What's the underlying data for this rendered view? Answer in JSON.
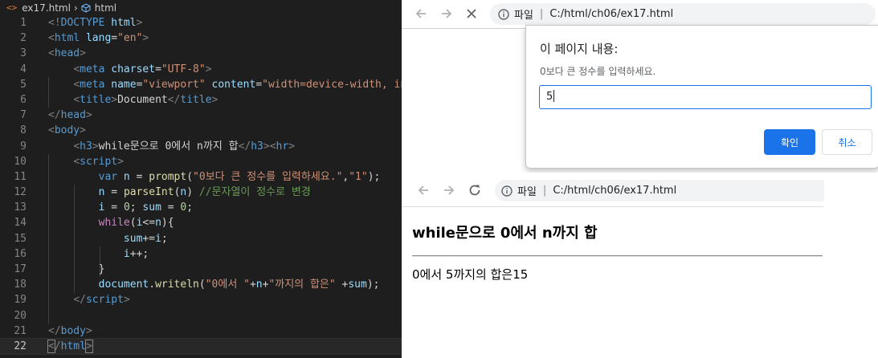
{
  "editor": {
    "breadcrumb": {
      "file": "ex17.html",
      "element": "html",
      "file_icon": "html-file-icon",
      "element_icon": "cube-icon"
    },
    "colors": {
      "background": "#1e1e1e",
      "tag": "#569cd6",
      "attribute": "#9cdcfe",
      "string": "#ce9178",
      "comment": "#6a9955",
      "function": "#dcdcaa",
      "keyword_control": "#c586c0",
      "number": "#b5cea8"
    },
    "active_line": 22,
    "lines": [
      {
        "n": "1",
        "segs": [
          [
            "t-br",
            "<!"
          ],
          [
            "t-tag",
            "DOCTYPE"
          ],
          [
            "t-at",
            " html"
          ],
          [
            "t-br",
            ">"
          ]
        ]
      },
      {
        "n": "2",
        "segs": [
          [
            "t-br",
            "<"
          ],
          [
            "t-tag",
            "html"
          ],
          [
            "t-at",
            " lang"
          ],
          [
            "t-tx",
            "="
          ],
          [
            "t-str",
            "\"en\""
          ],
          [
            "t-br",
            ">"
          ]
        ]
      },
      {
        "n": "3",
        "segs": [
          [
            "t-br",
            "<"
          ],
          [
            "t-tag",
            "head"
          ],
          [
            "t-br",
            ">"
          ]
        ]
      },
      {
        "n": "4",
        "segs": [
          [
            "t-tx",
            "    "
          ],
          [
            "t-br",
            "<"
          ],
          [
            "t-tag",
            "meta"
          ],
          [
            "t-at",
            " charset"
          ],
          [
            "t-tx",
            "="
          ],
          [
            "t-str",
            "\"UTF-8\""
          ],
          [
            "t-br",
            ">"
          ]
        ]
      },
      {
        "n": "5",
        "segs": [
          [
            "t-tx",
            "    "
          ],
          [
            "t-br",
            "<"
          ],
          [
            "t-tag",
            "meta"
          ],
          [
            "t-at",
            " name"
          ],
          [
            "t-tx",
            "="
          ],
          [
            "t-str",
            "\"viewport\""
          ],
          [
            "t-at",
            " content"
          ],
          [
            "t-tx",
            "="
          ],
          [
            "t-str",
            "\"width=device-width, ini"
          ]
        ]
      },
      {
        "n": "6",
        "segs": [
          [
            "t-tx",
            "    "
          ],
          [
            "t-br",
            "<"
          ],
          [
            "t-tag",
            "title"
          ],
          [
            "t-br",
            ">"
          ],
          [
            "t-tx",
            "Document"
          ],
          [
            "t-br",
            "</"
          ],
          [
            "t-tag",
            "title"
          ],
          [
            "t-br",
            ">"
          ]
        ]
      },
      {
        "n": "7",
        "segs": [
          [
            "t-br",
            "</"
          ],
          [
            "t-tag",
            "head"
          ],
          [
            "t-br",
            ">"
          ]
        ]
      },
      {
        "n": "8",
        "segs": [
          [
            "t-br",
            "<"
          ],
          [
            "t-tag",
            "body"
          ],
          [
            "t-br",
            ">"
          ]
        ]
      },
      {
        "n": "9",
        "segs": [
          [
            "t-tx",
            "    "
          ],
          [
            "t-br",
            "<"
          ],
          [
            "t-tag",
            "h3"
          ],
          [
            "t-br",
            ">"
          ],
          [
            "t-tx",
            "while문으로 0에서 n까지 합"
          ],
          [
            "t-br",
            "</"
          ],
          [
            "t-tag",
            "h3"
          ],
          [
            "t-br",
            "><"
          ],
          [
            "t-tag",
            "hr"
          ],
          [
            "t-br",
            ">"
          ]
        ]
      },
      {
        "n": "10",
        "segs": [
          [
            "t-tx",
            "    "
          ],
          [
            "t-br",
            "<"
          ],
          [
            "t-tag",
            "script"
          ],
          [
            "t-br",
            ">"
          ]
        ]
      },
      {
        "n": "11",
        "segs": [
          [
            "t-tx",
            "        "
          ],
          [
            "t-kw",
            "var"
          ],
          [
            "t-var",
            " n"
          ],
          [
            "t-op",
            " = "
          ],
          [
            "t-fn",
            "prompt"
          ],
          [
            "t-op",
            "("
          ],
          [
            "t-str",
            "\"0보다 큰 정수를 입력하세요.\""
          ],
          [
            "t-op",
            ","
          ],
          [
            "t-str",
            "\"1\""
          ],
          [
            "t-op",
            ");"
          ]
        ]
      },
      {
        "n": "12",
        "segs": [
          [
            "t-tx",
            "        "
          ],
          [
            "t-var",
            "n"
          ],
          [
            "t-op",
            " = "
          ],
          [
            "t-fn",
            "parseInt"
          ],
          [
            "t-op",
            "("
          ],
          [
            "t-var",
            "n"
          ],
          [
            "t-op",
            ") "
          ],
          [
            "t-cm",
            "//문자열이 정수로 변경"
          ]
        ]
      },
      {
        "n": "13",
        "segs": [
          [
            "t-tx",
            "        "
          ],
          [
            "t-var",
            "i"
          ],
          [
            "t-op",
            " = "
          ],
          [
            "t-num",
            "0"
          ],
          [
            "t-op",
            "; "
          ],
          [
            "t-var",
            "sum"
          ],
          [
            "t-op",
            " = "
          ],
          [
            "t-num",
            "0"
          ],
          [
            "t-op",
            ";"
          ]
        ]
      },
      {
        "n": "14",
        "segs": [
          [
            "t-tx",
            "        "
          ],
          [
            "t-ctl",
            "while"
          ],
          [
            "t-op",
            "("
          ],
          [
            "t-var",
            "i"
          ],
          [
            "t-op",
            "<="
          ],
          [
            "t-var",
            "n"
          ],
          [
            "t-op",
            "){"
          ]
        ]
      },
      {
        "n": "15",
        "segs": [
          [
            "t-tx",
            "            "
          ],
          [
            "t-var",
            "sum"
          ],
          [
            "t-op",
            "+="
          ],
          [
            "t-var",
            "i"
          ],
          [
            "t-op",
            ";"
          ]
        ]
      },
      {
        "n": "16",
        "segs": [
          [
            "t-tx",
            "            "
          ],
          [
            "t-var",
            "i"
          ],
          [
            "t-op",
            "++;"
          ]
        ]
      },
      {
        "n": "17",
        "segs": [
          [
            "t-tx",
            "        "
          ],
          [
            "t-op",
            "}"
          ]
        ]
      },
      {
        "n": "18",
        "segs": [
          [
            "t-tx",
            "        "
          ],
          [
            "t-var",
            "document"
          ],
          [
            "t-op",
            "."
          ],
          [
            "t-fn",
            "writeln"
          ],
          [
            "t-op",
            "("
          ],
          [
            "t-str",
            "\"0에서 \""
          ],
          [
            "t-op",
            "+"
          ],
          [
            "t-var",
            "n"
          ],
          [
            "t-op",
            "+"
          ],
          [
            "t-str",
            "\"까지의 합은\""
          ],
          [
            "t-op",
            " +"
          ],
          [
            "t-var",
            "sum"
          ],
          [
            "t-op",
            ");"
          ]
        ]
      },
      {
        "n": "19",
        "segs": [
          [
            "t-tx",
            "    "
          ],
          [
            "t-br",
            "</"
          ],
          [
            "t-tag",
            "script"
          ],
          [
            "t-br",
            ">"
          ]
        ]
      },
      {
        "n": "20",
        "segs": []
      },
      {
        "n": "21",
        "segs": [
          [
            "t-br",
            "</"
          ],
          [
            "t-tag",
            "body"
          ],
          [
            "t-br",
            ">"
          ]
        ]
      },
      {
        "n": "22",
        "segs": [
          [
            "t-br t-bm",
            "<"
          ],
          [
            "t-br",
            "/"
          ],
          [
            "t-tag",
            "html"
          ],
          [
            "t-br t-bm",
            ">"
          ]
        ]
      }
    ]
  },
  "browser_top": {
    "nav": {
      "back_icon": "back-arrow-icon",
      "forward_icon": "forward-arrow-icon",
      "stop_icon": "close-icon"
    },
    "address": {
      "scheme_label": "파일",
      "url": "C:/html/ch06/ex17.html",
      "icon": "info-icon"
    },
    "dialog": {
      "title": "이 페이지 내용:",
      "message": "0보다 큰 정수를 입력하세요.",
      "input_value": "5",
      "ok_label": "확인",
      "cancel_label": "취소",
      "accent": "#1a73e8"
    }
  },
  "browser_bottom": {
    "nav": {
      "back_icon": "back-arrow-icon",
      "forward_icon": "forward-arrow-icon",
      "reload_icon": "reload-icon"
    },
    "address": {
      "scheme_label": "파일",
      "url": "C:/html/ch06/ex17.html",
      "icon": "info-icon"
    },
    "page": {
      "heading": "while문으로 0에서 n까지 합",
      "output": "0에서 5까지의 합은15"
    }
  }
}
